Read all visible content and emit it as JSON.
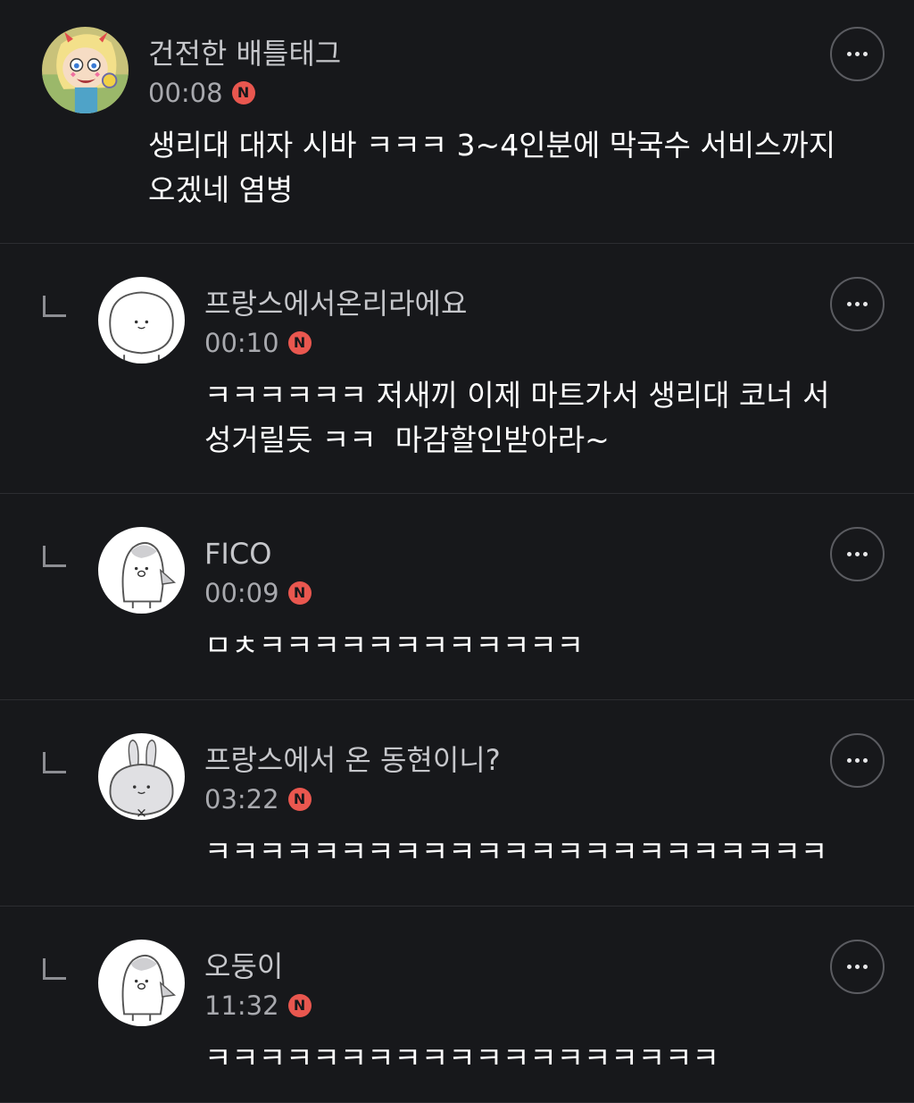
{
  "comments": [
    {
      "author": "건전한 배틀태그",
      "time": "00:08",
      "badge": "N",
      "text": "생리대 대자 시바 ㅋㅋㅋ 3~4인분에 막국수 서비스까지\n오겠네 염병",
      "avatar_icon": "cartoon-girl-avatar"
    },
    {
      "author": "프랑스에서온리라에요",
      "time": "00:10",
      "badge": "N",
      "text": "ㅋㅋㅋㅋㅋㅋ 저새끼 이제 마트가서 생리대 코너 서\n성거릴듯 ㅋㅋ  마감할인받아라~",
      "avatar_icon": "round-face-avatar"
    },
    {
      "author": "FICO",
      "time": "00:09",
      "badge": "N",
      "text": "ㅁㅊㅋㅋㅋㅋㅋㅋㅋㅋㅋㅋㅋㅋ",
      "avatar_icon": "penguin-avatar"
    },
    {
      "author": "프랑스에서 온 동현이니?",
      "time": "03:22",
      "badge": "N",
      "text": "ㅋㅋㅋㅋㅋㅋㅋㅋㅋㅋㅋㅋㅋㅋㅋㅋㅋㅋㅋㅋㅋㅋㅋ",
      "avatar_icon": "bunny-avatar"
    },
    {
      "author": "오둥이",
      "time": "11:32",
      "badge": "N",
      "text": "ㅋㅋㅋㅋㅋㅋㅋㅋㅋㅋㅋㅋㅋㅋㅋㅋㅋㅋㅋ",
      "avatar_icon": "penguin-avatar"
    }
  ],
  "colors": {
    "background": "#17181b",
    "divider": "#2c2d31",
    "badge": "#e9574f"
  }
}
